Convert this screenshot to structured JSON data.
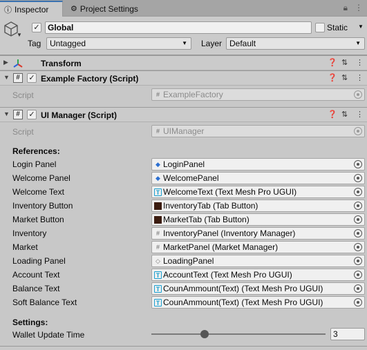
{
  "tabs": {
    "inspector": "Inspector",
    "project_settings": "Project Settings"
  },
  "object": {
    "name": "Global",
    "active_checked": true,
    "static_label": "Static",
    "static_checked": false,
    "tag_label": "Tag",
    "tag_value": "Untagged",
    "layer_label": "Layer",
    "layer_value": "Default"
  },
  "components": {
    "transform": {
      "title": "Transform"
    },
    "example_factory": {
      "title": "Example Factory (Script)",
      "enabled": true,
      "script_label": "Script",
      "script_value": "ExampleFactory"
    },
    "ui_manager": {
      "title": "UI Manager (Script)",
      "enabled": true,
      "script_label": "Script",
      "script_value": "UIManager"
    }
  },
  "references": {
    "header": "References:",
    "rows": [
      {
        "label": "Login Panel",
        "value": "LoginPanel",
        "icon": "cube-icon"
      },
      {
        "label": "Welcome Panel",
        "value": "WelcomePanel",
        "icon": "cube-icon"
      },
      {
        "label": "Welcome Text",
        "value": "WelcomeText (Text Mesh Pro UGUI)",
        "icon": "text-icon"
      },
      {
        "label": "Inventory Button",
        "value": "InventoryTab (Tab Button)",
        "icon": "tab-icon"
      },
      {
        "label": "Market Button",
        "value": "MarketTab (Tab Button)",
        "icon": "tab-icon"
      },
      {
        "label": "Inventory",
        "value": "InventoryPanel (Inventory Manager)",
        "icon": "script-icon"
      },
      {
        "label": "Market",
        "value": "MarketPanel (Market Manager)",
        "icon": "script-icon"
      },
      {
        "label": "Loading Panel",
        "value": "LoadingPanel",
        "icon": "prefab-icon"
      },
      {
        "label": "Account Text",
        "value": "AccountText (Text Mesh Pro UGUI)",
        "icon": "text-icon"
      },
      {
        "label": "Balance Text",
        "value": "CounAmmount(Text) (Text Mesh Pro UGUI)",
        "icon": "text-icon"
      },
      {
        "label": "Soft Balance Text",
        "value": "CounAmmount(Text) (Text Mesh Pro UGUI)",
        "icon": "text-icon"
      }
    ]
  },
  "settings": {
    "header": "Settings:",
    "wallet_label": "Wallet Update Time",
    "wallet_value": "3"
  },
  "colors": {
    "accent": "#3a72b0",
    "panel": "#cbcbcb",
    "field": "#f0f0f0"
  }
}
